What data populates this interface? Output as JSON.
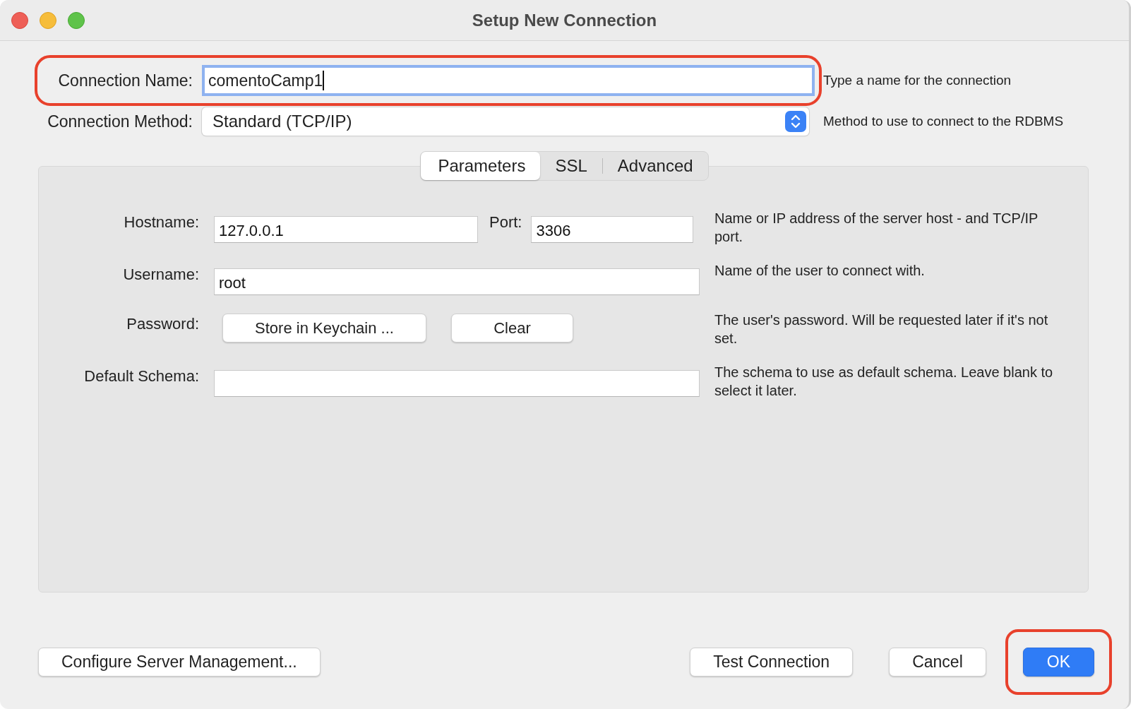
{
  "window": {
    "title": "Setup New Connection"
  },
  "connection_name": {
    "label": "Connection Name:",
    "value": "comentoCamp1",
    "focused": true,
    "highlighted": true,
    "hint": "Type a name for the connection"
  },
  "connection_method": {
    "label": "Connection Method:",
    "value": "Standard (TCP/IP)",
    "hint": "Method to use to connect to the RDBMS"
  },
  "tabs": [
    {
      "label": "Parameters",
      "selected": true
    },
    {
      "label": "SSL",
      "selected": false
    },
    {
      "label": "Advanced",
      "selected": false
    }
  ],
  "parameters": [
    {
      "kind": "host_port",
      "label": "Hostname:",
      "value": "127.0.0.1",
      "port_label": "Port:",
      "port_value": "3306",
      "help": "Name or IP address of the server host - and TCP/IP port."
    },
    {
      "kind": "text",
      "label": "Username:",
      "value": "root",
      "help": "Name of the user to connect with."
    },
    {
      "kind": "buttons",
      "label": "Password:",
      "buttons": [
        "Store in Keychain ...",
        "Clear"
      ],
      "help": "The user's password. Will be requested later if it's not set."
    },
    {
      "kind": "text",
      "label": "Default Schema:",
      "help": "The schema to use as default schema. Leave blank to select it later."
    }
  ],
  "buttons": [
    {
      "label": "Configure Server Management...",
      "kind": "plain",
      "highlighted": false
    },
    {
      "label": "Test Connection",
      "kind": "plain",
      "highlighted": false
    },
    {
      "label": "Cancel",
      "kind": "plain",
      "highlighted": false
    },
    {
      "label": "OK",
      "kind": "default",
      "highlighted": true
    }
  ]
}
